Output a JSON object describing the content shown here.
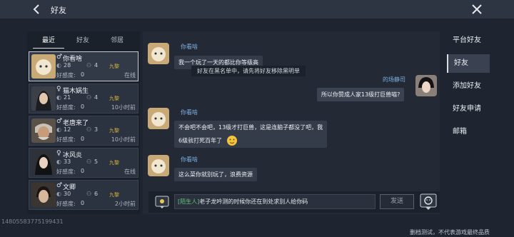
{
  "header": {
    "title": "好友"
  },
  "tabs": [
    "最近",
    "好友",
    "邻居"
  ],
  "friends": [
    {
      "name": "你看啥",
      "gender": "♂",
      "level": "28",
      "team": "4",
      "faction": "九黎",
      "favor_label": "好感度:",
      "favor": "0",
      "status": "在线"
    },
    {
      "name": "猫木娲生",
      "gender": "♀",
      "level": "21",
      "team": "4",
      "faction": "九黎",
      "favor_label": "好感度:",
      "favor": "0",
      "status": "10小时前"
    },
    {
      "name": "老唐来了",
      "gender": "♂",
      "level": "12",
      "team": "3",
      "faction": "九黎",
      "favor_label": "好感度:",
      "favor": "0",
      "status": "10小时前"
    },
    {
      "name": "冰风炎",
      "gender": "♀",
      "level": "33",
      "team": "5",
      "faction": "九黎",
      "favor_label": "好感度:",
      "favor": "0",
      "status": "在线"
    },
    {
      "name": "文卿",
      "gender": "♂",
      "level": "30",
      "team": "6",
      "faction": "九黎",
      "favor_label": "好感度:",
      "favor": "0",
      "status": "2小时前"
    }
  ],
  "chat": {
    "messages": [
      {
        "sender": "你看啥",
        "text": "我一个玩了一天的都比你等级高"
      },
      {
        "sender": "的场静司",
        "text": "所以你赞成人家13级打巨兽喵?"
      },
      {
        "sender": "你看啥",
        "text_line1": "不会吧不会吧，13级才打巨兽，这是连脑子都没了吧，我",
        "text_line2": "6级就打死百年了"
      },
      {
        "sender": "你看啥",
        "text": "这么菜你就别玩了，浪费资源"
      }
    ],
    "system_note": "好友在黑名单中，请先将好友移除黑明单",
    "input": {
      "tag": "[陌生人]",
      "value": "老子龙吟测的时候你还在到处求别人给你码"
    },
    "send_label": "发送"
  },
  "right_menu": [
    "平台好友",
    "好友",
    "添加好友",
    "好友申请",
    "邮箱"
  ],
  "footer": {
    "id": "14805583775199431",
    "note": "删档测试，不代表游戏最终品质"
  },
  "colors": {
    "accent_name": "#7fb1e4",
    "faction": "#d9b43a",
    "stranger_tag": "#66c47a"
  }
}
